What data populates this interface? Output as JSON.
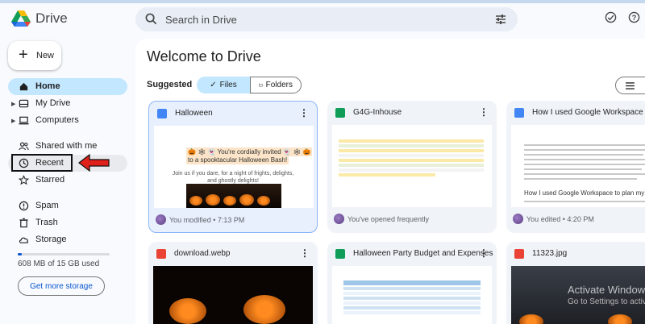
{
  "app": {
    "name": "Drive"
  },
  "search": {
    "placeholder": "Search in Drive"
  },
  "sidebar": {
    "new_label": "New",
    "items": [
      {
        "label": "Home"
      },
      {
        "label": "My Drive"
      },
      {
        "label": "Computers"
      },
      {
        "label": "Shared with me"
      },
      {
        "label": "Recent"
      },
      {
        "label": "Starred"
      },
      {
        "label": "Spam"
      },
      {
        "label": "Trash"
      },
      {
        "label": "Storage"
      }
    ],
    "storage_text": "608 MB of 15 GB used",
    "storage_fraction": 0.04,
    "get_storage_label": "Get more storage"
  },
  "main": {
    "title": "Welcome to Drive",
    "suggested_label": "Suggested",
    "chips": {
      "files": "Files",
      "folders": "Folders"
    },
    "cards": [
      {
        "title": "Halloween",
        "meta": "You modified • 7:13 PM",
        "icon": "docs-icon",
        "color": "#4285f4"
      },
      {
        "title": "G4G-Inhouse",
        "meta": "You've opened frequently",
        "icon": "sheets-icon",
        "color": "#0f9d58"
      },
      {
        "title": "How I used Google Workspace to p",
        "meta": "You edited • 4:20 PM",
        "icon": "docs-icon",
        "color": "#4285f4"
      },
      {
        "title": "download.webp",
        "icon": "image-icon",
        "color": "#ea4335"
      },
      {
        "title": "Halloween Party Budget and Expenses",
        "icon": "sheets-icon",
        "color": "#0f9d58"
      },
      {
        "title": "11323.jpg",
        "icon": "image-icon",
        "color": "#ea4335"
      }
    ],
    "halloween_preview": {
      "line1": "🎃 🕸 👻 You're cordially invited 👻 🕸 🎃",
      "line2": "to a spooktacular Halloween Bash!",
      "line3": "Join us if you dare, for a night of frights, delights, and ghostly delights!"
    },
    "workspace_preview": {
      "heading": "How I used Google Workspace to plan my Halloween p"
    }
  },
  "overlay": {
    "line1": "Activate Window",
    "line2": "Go to Settings to activ"
  },
  "colors": {
    "accent": "#0b57d0",
    "active_nav": "#c2e7ff",
    "annotation_arrow": "#e0201b"
  }
}
